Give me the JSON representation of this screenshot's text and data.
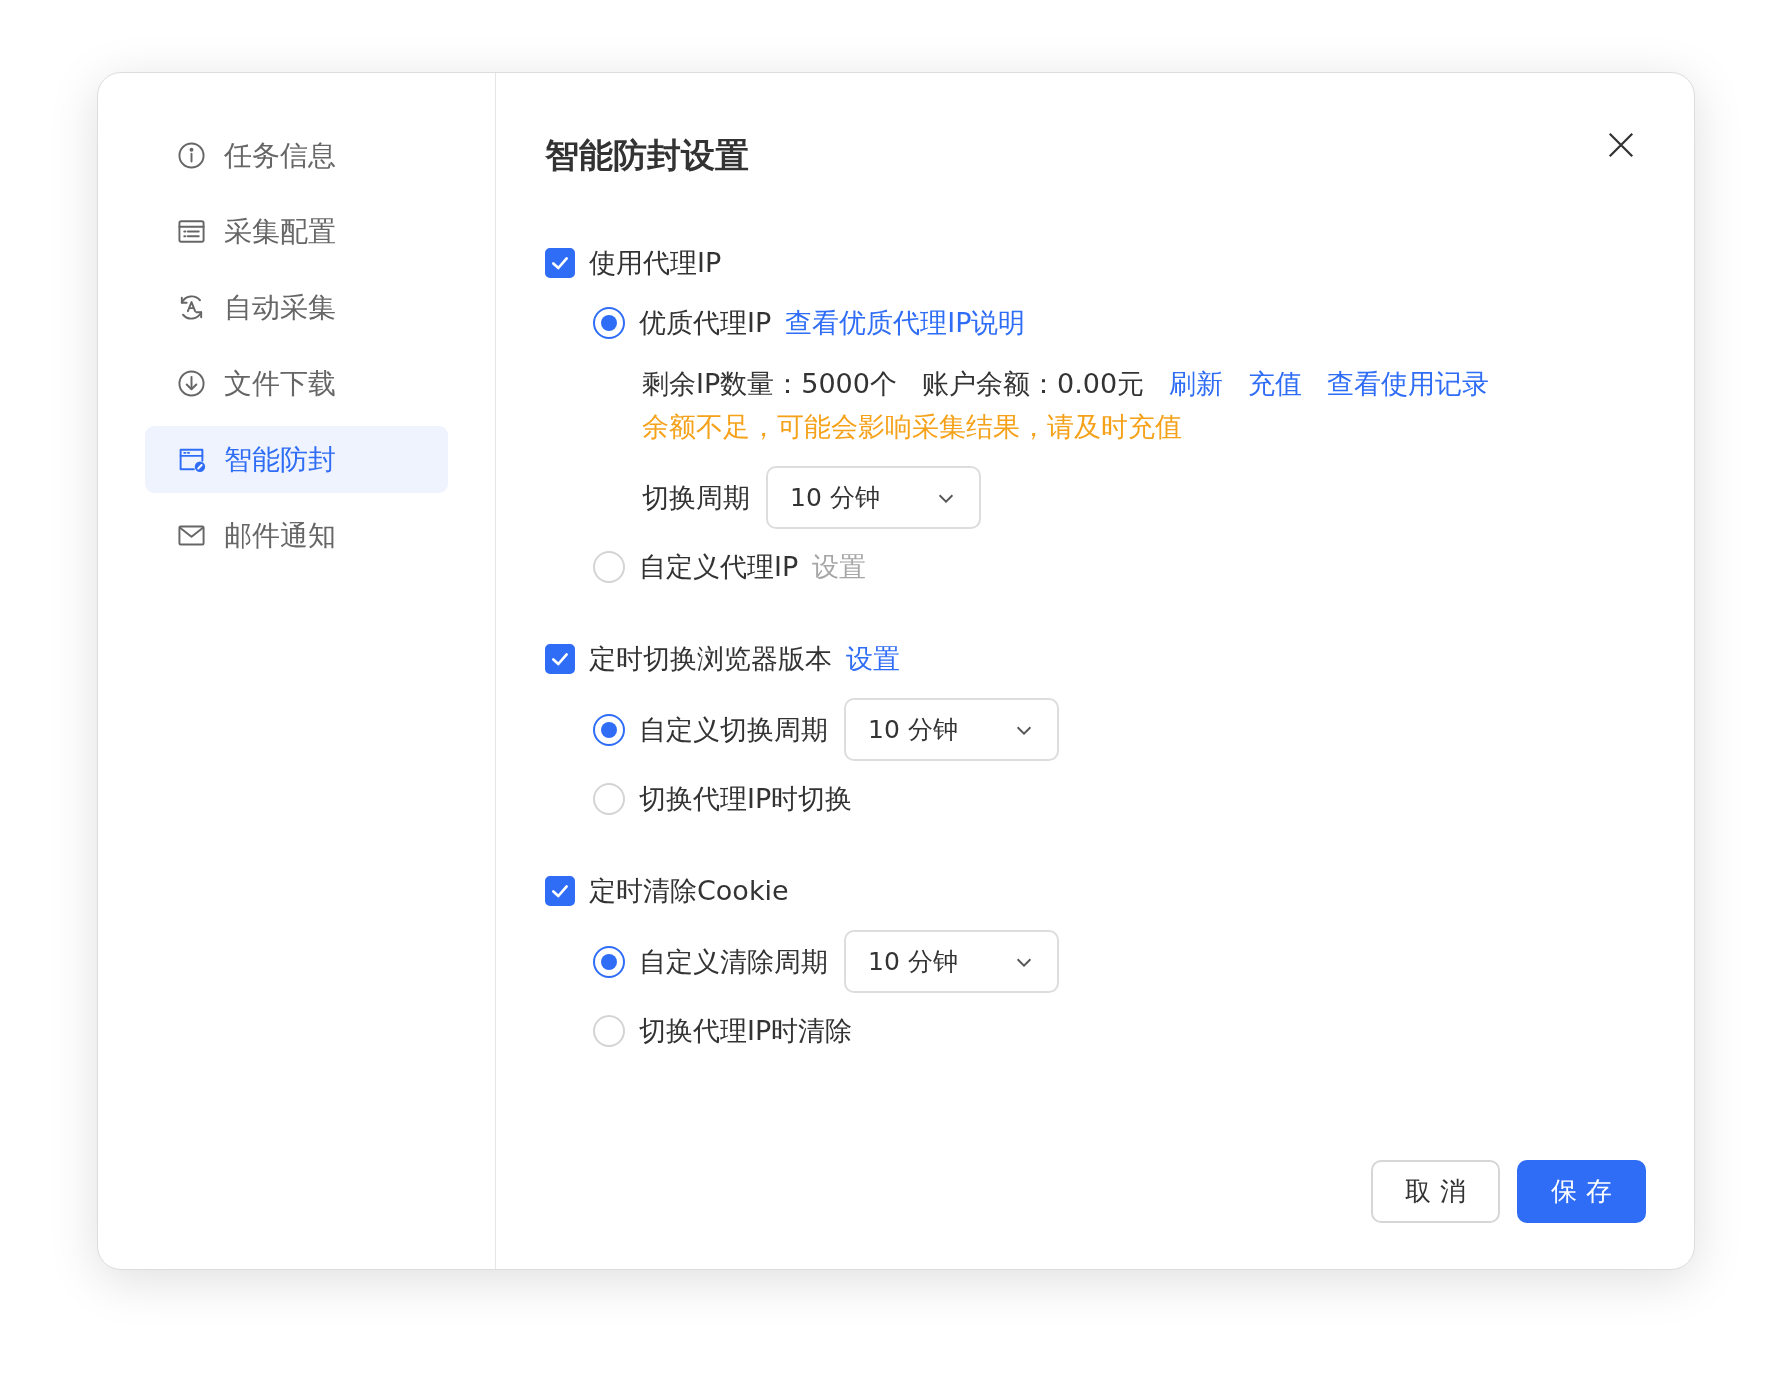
{
  "sidebar": {
    "items": [
      {
        "label": "任务信息",
        "selected": false
      },
      {
        "label": "采集配置",
        "selected": false
      },
      {
        "label": "自动采集",
        "selected": false
      },
      {
        "label": "文件下载",
        "selected": false
      },
      {
        "label": "智能防封",
        "selected": true
      },
      {
        "label": "邮件通知",
        "selected": false
      }
    ]
  },
  "dialog": {
    "title": "智能防封设置"
  },
  "sections": [
    {
      "label": "使用代理IP",
      "checked": true,
      "options": [
        {
          "label": "优质代理IP",
          "selected": true,
          "link": "查看优质代理IP说明",
          "link_disabled": false,
          "stats": [
            "剩余IP数量：5000个",
            "账户余额：0.00元"
          ],
          "actions": [
            "刷新",
            "充值",
            "查看使用记录"
          ],
          "warning": "余额不足，可能会影响采集结果，请及时充值",
          "period": {
            "label": "切换周期",
            "value": "10 分钟"
          }
        },
        {
          "label": "自定义代理IP",
          "selected": false,
          "link": "设置",
          "link_disabled": true
        }
      ]
    },
    {
      "label": "定时切换浏览器版本",
      "checked": true,
      "link": "设置",
      "options": [
        {
          "label": "自定义切换周期",
          "selected": true,
          "select": "10 分钟"
        },
        {
          "label": "切换代理IP时切换",
          "selected": false
        }
      ]
    },
    {
      "label": "定时清除Cookie",
      "checked": true,
      "options": [
        {
          "label": "自定义清除周期",
          "selected": true,
          "select": "10 分钟"
        },
        {
          "label": "切换代理IP时清除",
          "selected": false
        }
      ]
    }
  ],
  "buttons": [
    {
      "label": "取 消",
      "kind": "secondary"
    },
    {
      "label": "保 存",
      "kind": "primary"
    }
  ]
}
